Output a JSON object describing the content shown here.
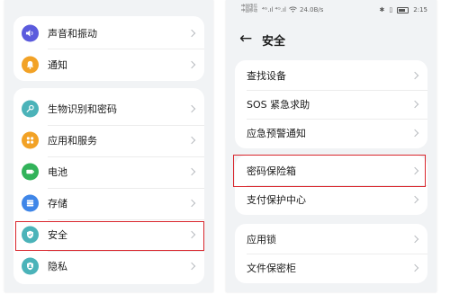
{
  "left_screen": {
    "groups": [
      [
        {
          "label": "声音和振动",
          "icon": "speaker-icon",
          "color": "#5b5bdd"
        },
        {
          "label": "通知",
          "icon": "bell-icon",
          "color": "#f2a226"
        }
      ],
      [
        {
          "label": "生物识别和密码",
          "icon": "key-icon",
          "color": "#4bb3b9"
        },
        {
          "label": "应用和服务",
          "icon": "grid-icon",
          "color": "#f2a226"
        },
        {
          "label": "电池",
          "icon": "battery-icon",
          "color": "#32b35a"
        },
        {
          "label": "存储",
          "icon": "storage-icon",
          "color": "#3f86e8"
        },
        {
          "label": "安全",
          "icon": "shield-check-icon",
          "color": "#4bb3b9"
        },
        {
          "label": "隐私",
          "icon": "shield-person-icon",
          "color": "#4bb3b9"
        }
      ]
    ]
  },
  "right_screen": {
    "status": {
      "carrier1": "中国电信",
      "carrier2": "中国移动",
      "signal": "⁴ᴳ.ıl ⁴ᴳ.ıl",
      "speed": "24.0B/s",
      "time": "2:15"
    },
    "back_icon": "←",
    "title": "安全",
    "groups": [
      [
        "查找设备",
        "SOS 紧急求助",
        "应急预警通知"
      ],
      [
        "密码保险箱",
        "支付保护中心"
      ],
      [
        "应用锁",
        "文件保密柜"
      ]
    ]
  },
  "highlight_color": "#d9252c"
}
